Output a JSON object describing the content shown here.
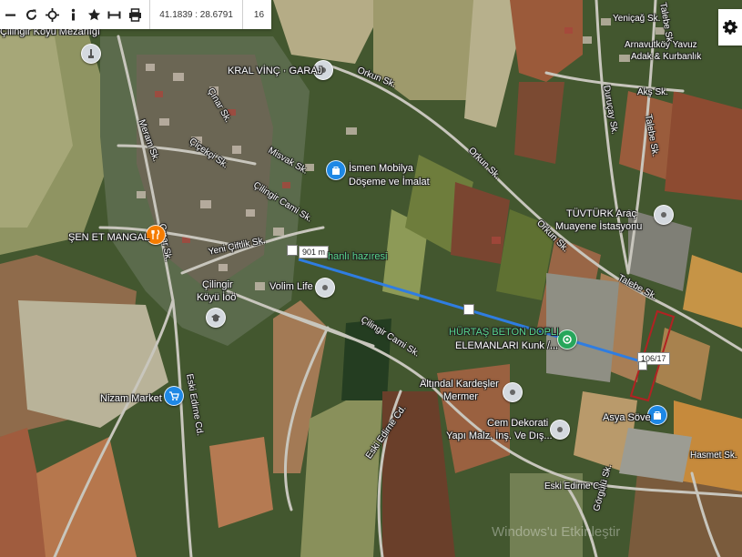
{
  "toolbar": {
    "buttons": [
      {
        "name": "minus-tool",
        "icon": "minus-icon"
      },
      {
        "name": "refresh-tool",
        "icon": "refresh-icon"
      },
      {
        "name": "crosshair-tool",
        "icon": "crosshair-icon"
      },
      {
        "name": "info-tool",
        "icon": "info-icon"
      },
      {
        "name": "favorite-tool",
        "icon": "star-icon"
      },
      {
        "name": "measure-tool",
        "icon": "measure-icon"
      },
      {
        "name": "print-tool",
        "icon": "printer-icon"
      }
    ],
    "coordinates": "41.1839 : 28.6791",
    "zoom": "16"
  },
  "settings": {
    "icon": "gear-icon"
  },
  "streets": {
    "yenicag": "Yeniçağ Sk.",
    "talebe_top": "Talebe Sk.",
    "arnavutkoy": "Arnavutköy Yavuz",
    "adak": "Adak & Kurbanlık",
    "orkun1": "Orkun Sk.",
    "durucay": "Duruçay Sk.",
    "aks": "Akş Sk.",
    "cinar1": "Çınar Sk.",
    "meram": "Meram Sk.",
    "cicekci": "Çiçekçi Sk.",
    "misvak": "Misvak Sk.",
    "orkun2": "Orkun Sk.",
    "talebe_mid": "Talebe Sk.",
    "cilingir_cami": "Çilingir Cami Sk.",
    "cinar2": "Çınar Sk.",
    "yeni_ciftlik": "Yeni Çiftlik Sk.",
    "orkun3": "Orkun Sk.",
    "talebe_low": "Talebe Sk.",
    "cilingir_cami2": "Çilingir Cami Sk.",
    "eski_edirne1": "Eski Edirne Cd.",
    "eski_edirne2": "Eski Edirne Cd.",
    "eski_edirne3": "Eski Edirne Cd.",
    "gorgulu": "Görgülü Sk.",
    "hasmet": "Hasmet Sk."
  },
  "pois": {
    "mezarligi": "Çilingir Köyü Mezarlığı",
    "kral_vinc": "KRAL VİNÇ · GARAJ",
    "ismen_1": "İsmen Mobilya",
    "ismen_2": "Döşeme ve İmalat",
    "tuvturk_1": "TÜVTÜRK Araç",
    "tuvturk_2": "Muayene İstasyonu",
    "sen_et": "ŞEN ET MANGAL",
    "hanli": "hanlı hazıresi",
    "cilingir_koyu_1": "Çilingir",
    "cilingir_koyu_2": "Köyü İöö",
    "volim": "Volim Life",
    "hurtas_1": "HÜRTAŞ BETON DOPLI",
    "hurtas_2": "ELEMANLARI Kunk /...",
    "nizam": "Nizam Market",
    "altindal_1": "Altındal Kardeşler",
    "altindal_2": "Mermer",
    "cem_1": "Cem Dekorati",
    "cem_2": "Yapı Malz. İnş. Ve Dış...",
    "asya": "Asya Söve"
  },
  "measurement": {
    "distance": "901 m",
    "parcel": "106/17",
    "line_color": "#2f7de1",
    "parcel_color": "#b22222"
  },
  "watermark": "Windows'u Etkinleştir"
}
